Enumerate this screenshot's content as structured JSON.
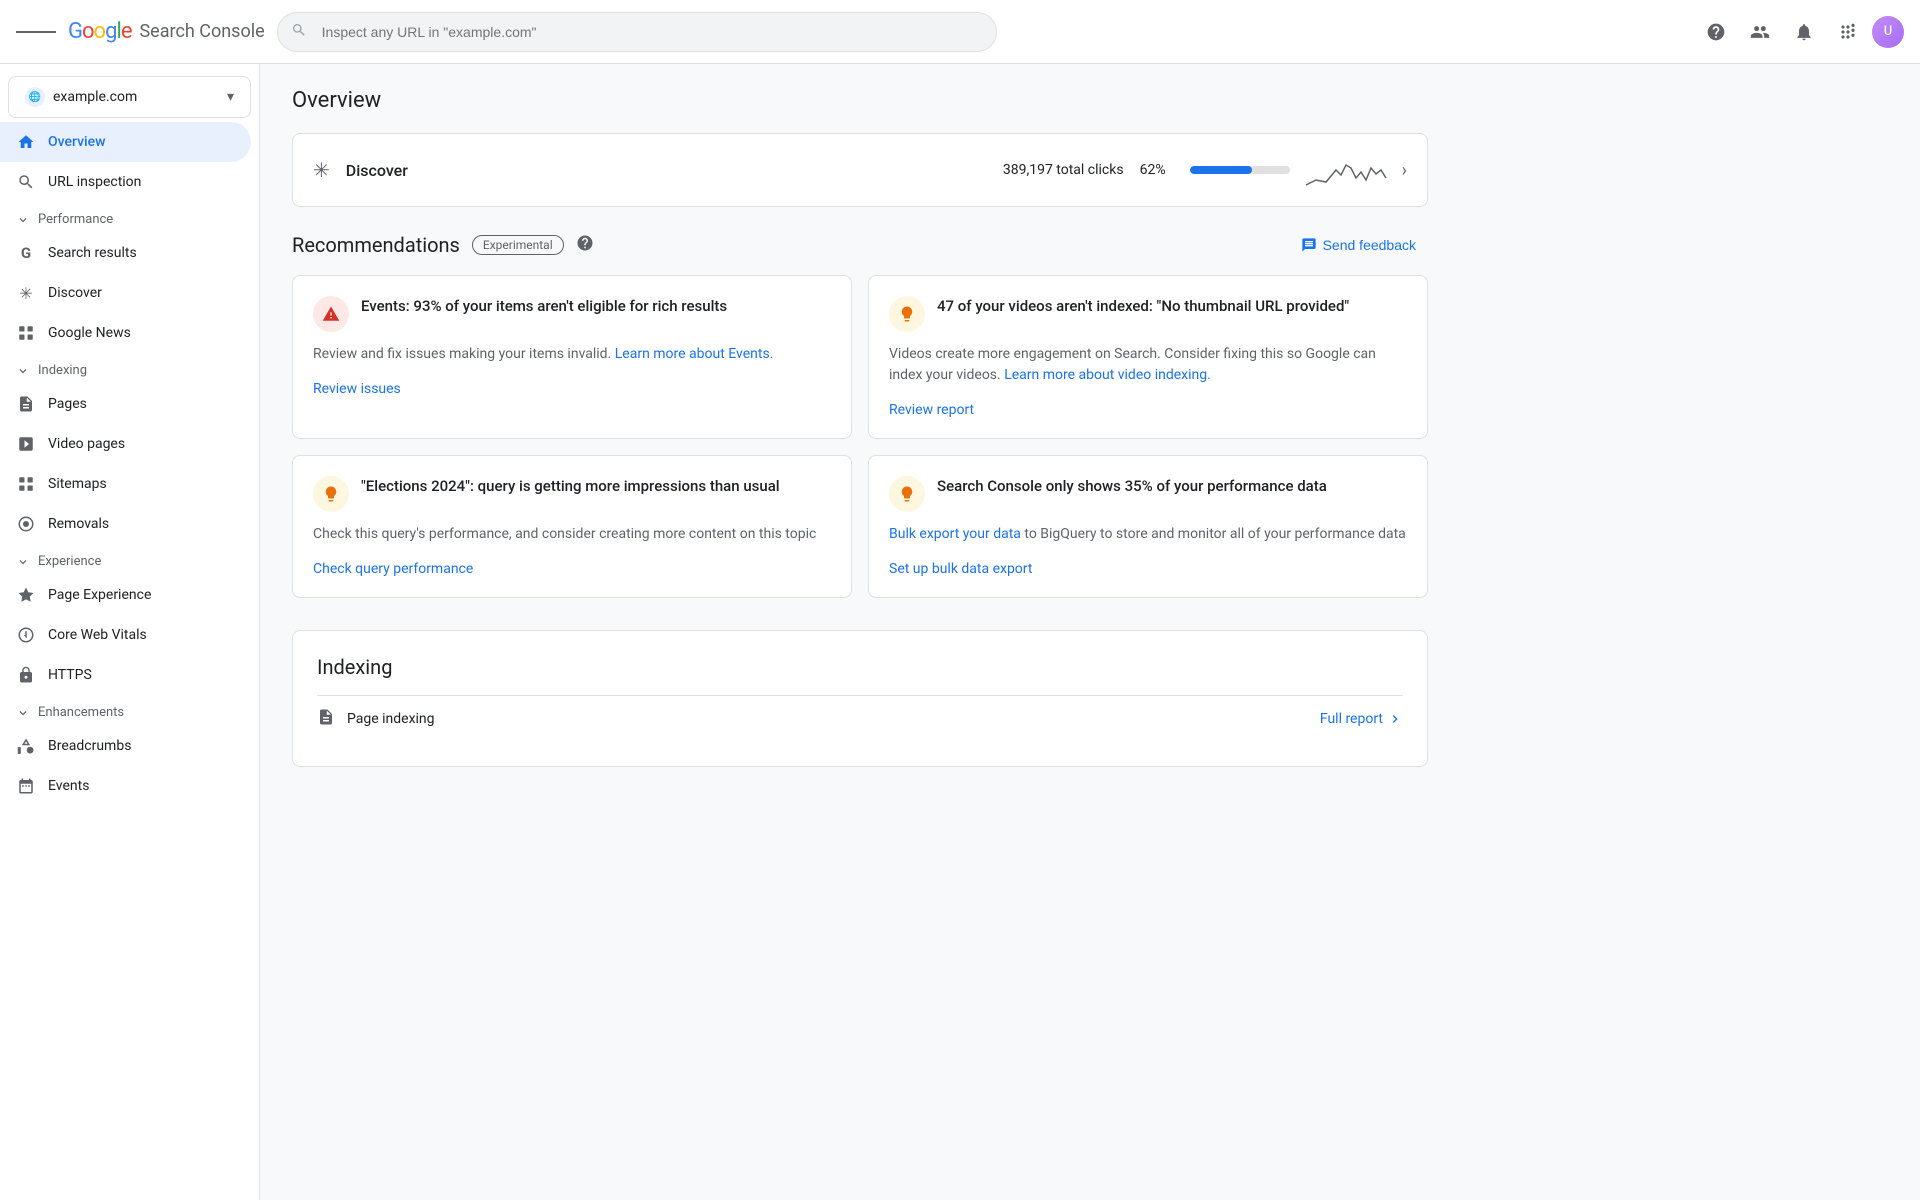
{
  "topbar": {
    "menu_icon": "menu-icon",
    "logo": {
      "g": "G",
      "o1": "o",
      "o2": "o",
      "g2": "g",
      "l": "l",
      "e": "e",
      "title": "Search Console"
    },
    "search_placeholder": "Inspect any URL in \"example.com\"",
    "actions": {
      "help": "?",
      "people": "👤",
      "bell": "🔔",
      "apps": "⠿"
    }
  },
  "sidebar": {
    "property": {
      "name": "example.com",
      "chevron": "▾"
    },
    "nav": [
      {
        "id": "overview",
        "label": "Overview",
        "icon": "home",
        "active": true
      },
      {
        "id": "url-inspection",
        "label": "URL inspection",
        "icon": "search",
        "active": false
      }
    ],
    "sections": [
      {
        "id": "performance",
        "label": "Performance",
        "items": [
          {
            "id": "search-results",
            "label": "Search results",
            "icon": "G"
          },
          {
            "id": "discover",
            "label": "Discover",
            "icon": "✳"
          },
          {
            "id": "google-news",
            "label": "Google News",
            "icon": "⊞"
          }
        ]
      },
      {
        "id": "indexing",
        "label": "Indexing",
        "items": [
          {
            "id": "pages",
            "label": "Pages",
            "icon": "📄"
          },
          {
            "id": "video-pages",
            "label": "Video pages",
            "icon": "▣"
          },
          {
            "id": "sitemaps",
            "label": "Sitemaps",
            "icon": "⊞"
          },
          {
            "id": "removals",
            "label": "Removals",
            "icon": "◎"
          }
        ]
      },
      {
        "id": "experience",
        "label": "Experience",
        "items": [
          {
            "id": "page-experience",
            "label": "Page Experience",
            "icon": "⬡"
          },
          {
            "id": "core-web-vitals",
            "label": "Core Web Vitals",
            "icon": "◑"
          },
          {
            "id": "https",
            "label": "HTTPS",
            "icon": "🔒"
          }
        ]
      },
      {
        "id": "enhancements",
        "label": "Enhancements",
        "items": [
          {
            "id": "breadcrumbs",
            "label": "Breadcrumbs",
            "icon": "◇"
          },
          {
            "id": "events",
            "label": "Events",
            "icon": "◈"
          }
        ]
      }
    ]
  },
  "main": {
    "page_title": "Overview",
    "discover": {
      "title": "Discover",
      "total_clicks": "389,197 total clicks",
      "percent": "62%",
      "progress": 62
    },
    "recommendations": {
      "title": "Recommendations",
      "badge": "Experimental",
      "send_feedback": "Send feedback",
      "cards": [
        {
          "id": "rich-results",
          "icon_type": "warning",
          "icon": "!",
          "title": "Events: 93% of your items aren't eligible for rich results",
          "description": "Review and fix issues making your items invalid.",
          "link_text": "Learn more about Events.",
          "action_label": "Review issues"
        },
        {
          "id": "video-indexing",
          "icon_type": "info",
          "icon": "💡",
          "title": "47 of your videos aren't indexed: \"No thumbnail URL provided\"",
          "description": "Videos create more engagement on Search. Consider fixing this so Google can index your videos.",
          "link_text": "Learn more about video indexing.",
          "action_label": "Review report"
        },
        {
          "id": "elections",
          "icon_type": "info",
          "icon": "💡",
          "title": "\"Elections 2024\": query is getting more impressions than usual",
          "description": "Check this query's performance, and consider creating more content on this topic",
          "link_text": "",
          "action_label": "Check query performance"
        },
        {
          "id": "bulk-export",
          "icon_type": "info",
          "icon": "💡",
          "title": "Search Console only shows 35% of your performance data",
          "description": " to BigQuery to store and monitor all of your performance data",
          "link_text": "Bulk export your data",
          "action_label": "Set up bulk data export"
        }
      ]
    },
    "indexing": {
      "title": "Indexing",
      "rows": [
        {
          "label": "Page indexing",
          "full_report": "Full report"
        }
      ]
    }
  }
}
